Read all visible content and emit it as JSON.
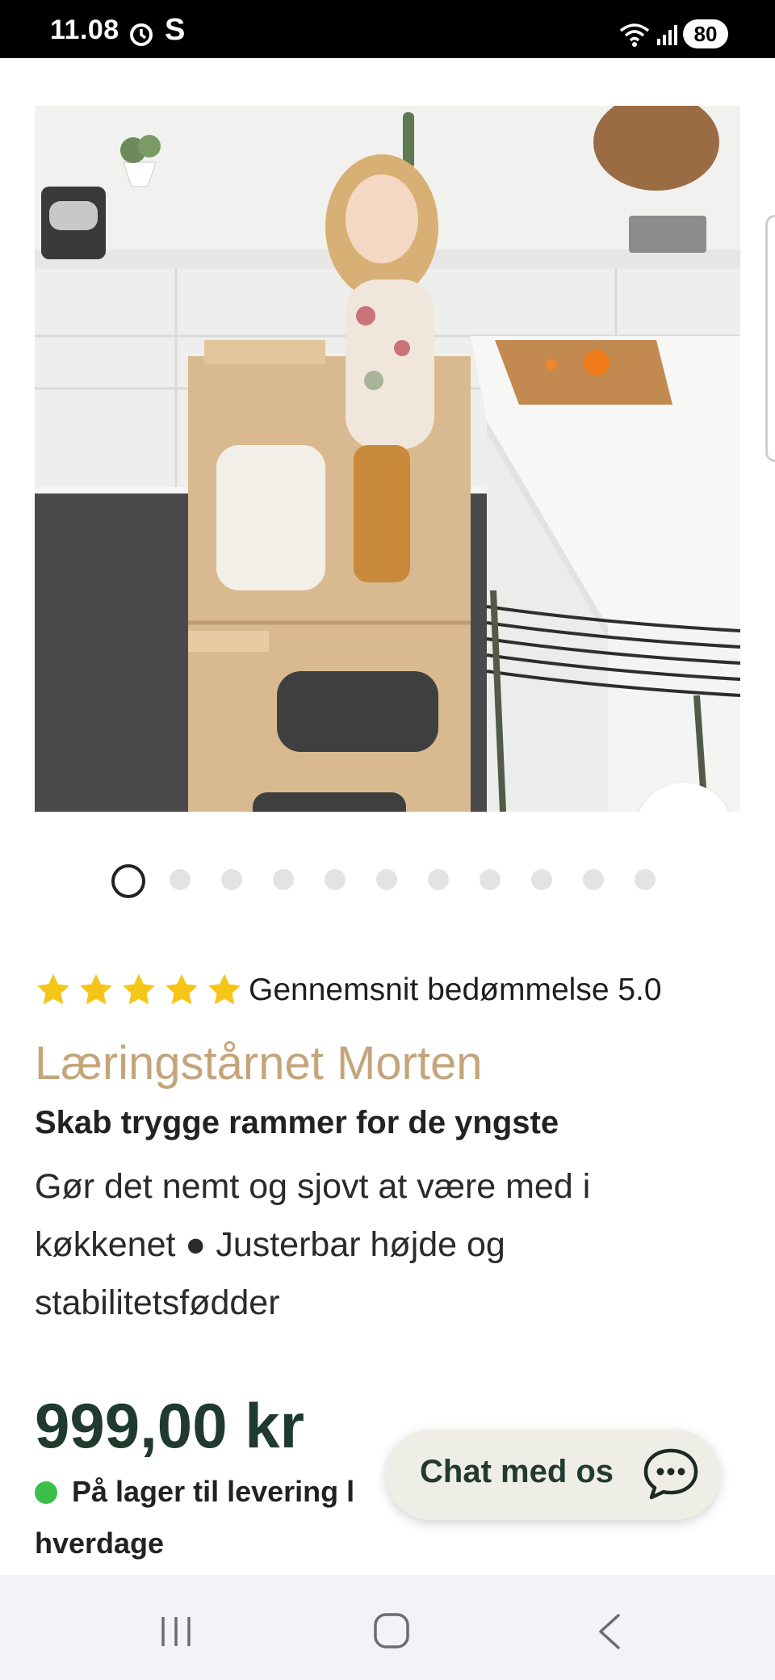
{
  "status_bar": {
    "time": "11.08",
    "carrier_letter": "S",
    "battery": "80"
  },
  "gallery": {
    "total_images": 11,
    "active_index": 0
  },
  "rating": {
    "stars": 5,
    "text": "Gennemsnit bedømmelse 5.0",
    "star_color": "#f5c518"
  },
  "product": {
    "title": "Læringstårnet Morten",
    "subtitle": "Skab trygge rammer for de yngste",
    "description": "Gør det nemt og sjovt at være med i køkkenet ● Justerbar højde og stabilitetsfødder",
    "price": "999,00 kr",
    "stock_text": "På lager til levering l",
    "stock_text_2": "hverdage",
    "title_color": "#c4a57b",
    "price_color": "#213a2f",
    "stock_color": "#3bbf48"
  },
  "chat": {
    "label": "Chat med os"
  },
  "icons": {
    "zoom": "zoom-in-icon",
    "chat": "chat-bubble-icon",
    "nav_recent": "recent-apps-icon",
    "nav_home": "home-icon",
    "nav_back": "back-icon"
  }
}
